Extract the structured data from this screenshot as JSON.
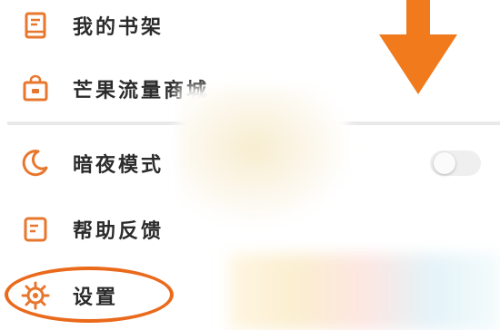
{
  "menu": {
    "items": [
      {
        "label": "我的书架",
        "icon": "bookshelf-icon"
      },
      {
        "label": "芒果流量商城",
        "icon": "shop-bag-icon"
      },
      {
        "label": "暗夜模式",
        "icon": "moon-icon"
      },
      {
        "label": "帮助反馈",
        "icon": "help-feedback-icon"
      },
      {
        "label": "设置",
        "icon": "gear-icon"
      }
    ],
    "dark_mode_enabled": false
  },
  "colors": {
    "accent": "#e8772e",
    "text": "#2b2b2b",
    "divider": "#e9e9e9"
  }
}
